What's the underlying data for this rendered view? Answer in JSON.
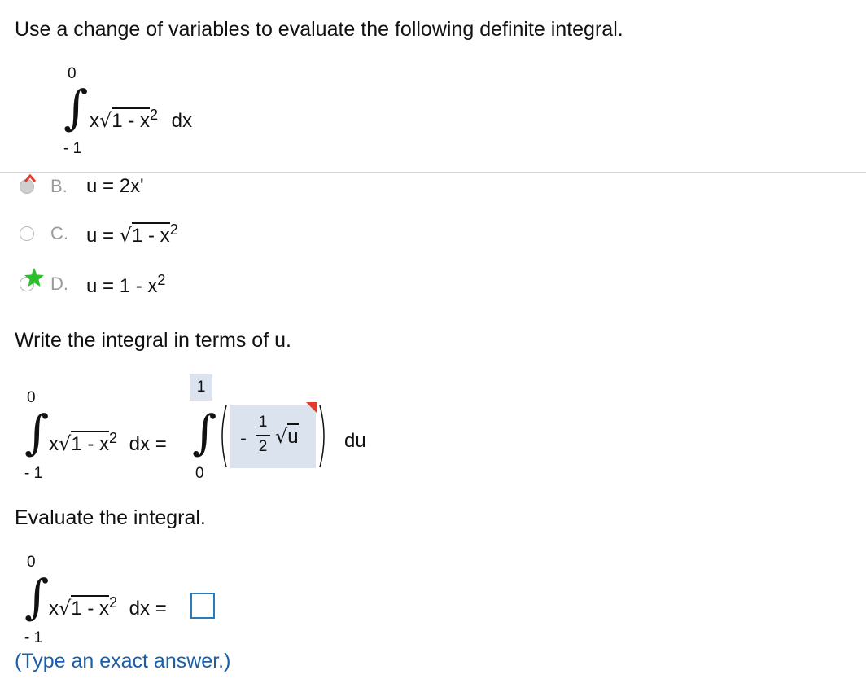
{
  "question": {
    "prompt": "Use a change of variables to evaluate the following definite integral.",
    "lower_limit": "- 1",
    "upper_limit": "0",
    "integrand_x": "x",
    "integrand_radicand": "1 - x",
    "exponent": "2",
    "dx": "dx"
  },
  "options": [
    {
      "letter": "B.",
      "expr": "u = 2x'",
      "state": "incorrect"
    },
    {
      "letter": "C.",
      "expr_prefix": "u =",
      "radicand": "1 - x",
      "exponent": "2",
      "state": "unselected"
    },
    {
      "letter": "D.",
      "expr": "u = 1 - x",
      "exponent": "2",
      "state": "correct"
    }
  ],
  "part2": {
    "prompt": "Write the integral in terms of u.",
    "lhs_lower": "- 1",
    "lhs_upper": "0",
    "lhs_expr_x": "x",
    "lhs_radicand": "1 - x",
    "lhs_exponent": "2",
    "lhs_dx": "dx =",
    "rhs_lower": "0",
    "rhs_upper": "1",
    "frac_sign": "-",
    "frac_num": "1",
    "frac_den": "2",
    "rhs_radicand": "u",
    "du": "du"
  },
  "part3": {
    "prompt": "Evaluate the integral.",
    "lower": "- 1",
    "upper": "0",
    "expr_x": "x",
    "radicand": "1 - x",
    "exponent": "2",
    "dx": "dx =",
    "answer_value": "",
    "hint": "(Type an exact answer.)"
  },
  "colors": {
    "accent_blue": "#2c7ab8",
    "correct_star": "#2bbf2b",
    "incorrect_mark": "#e23b2e",
    "highlight": "#dbe3ef"
  }
}
